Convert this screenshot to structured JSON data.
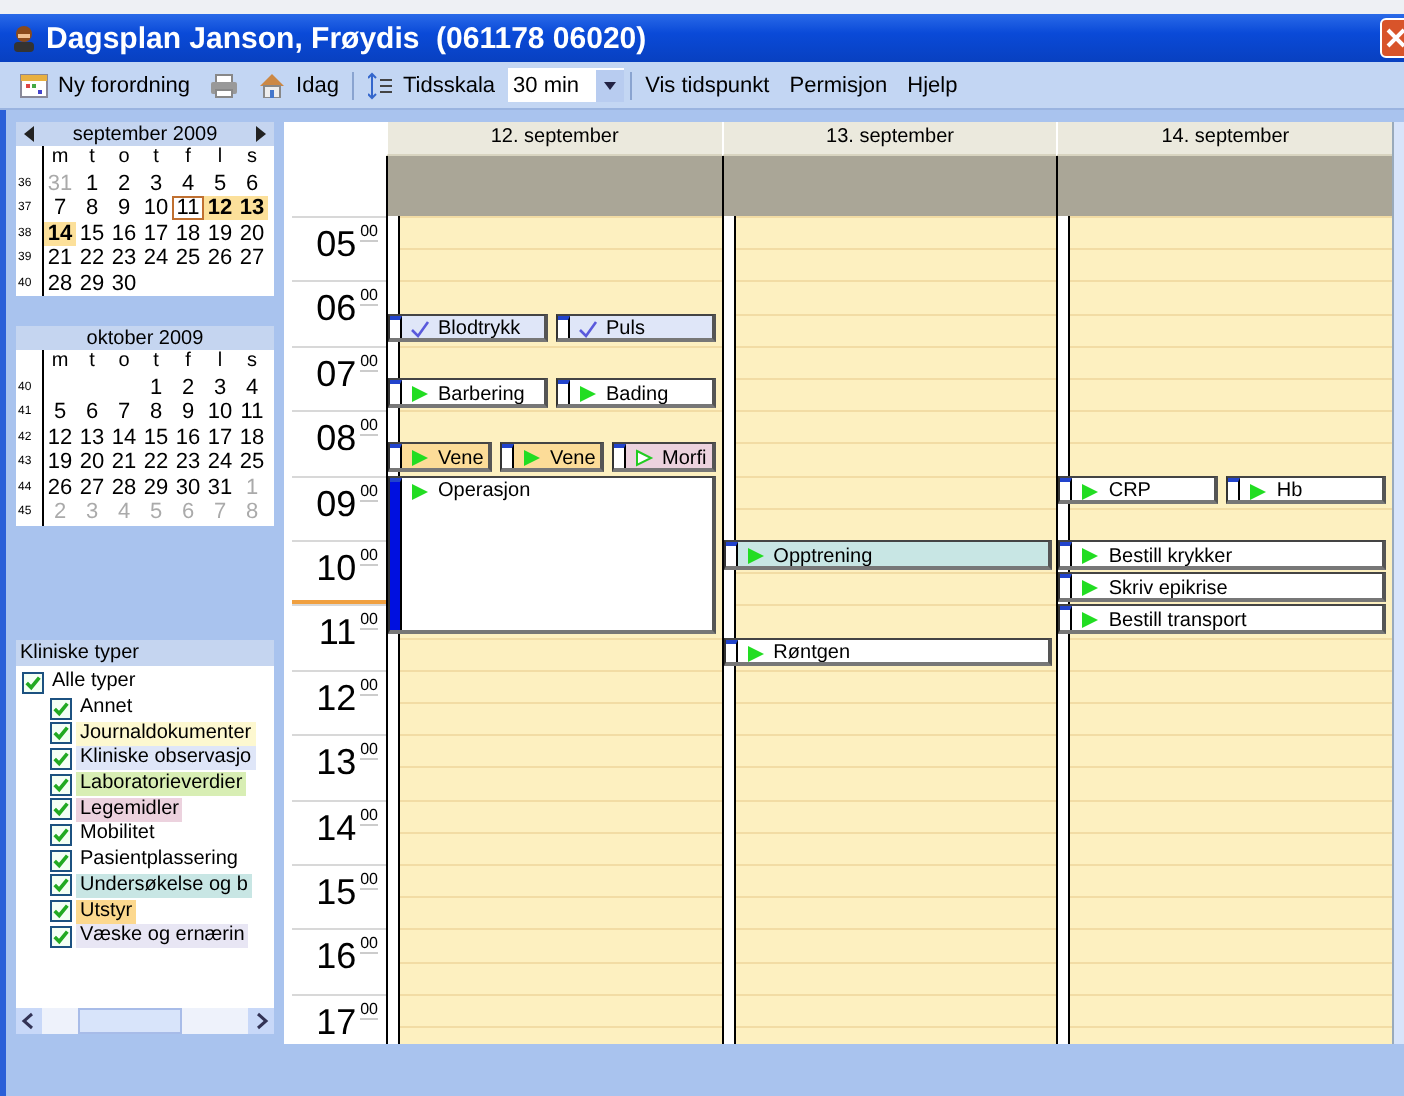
{
  "window": {
    "title": "Dagsplan Janson, Frøydis  (061178 06020)"
  },
  "toolbar": {
    "new_order": "Ny forordning",
    "today": "Idag",
    "time_scale": "Tidsskala",
    "scale_value": "30 min",
    "show_time": "Vis tidspunkt",
    "leave": "Permisjon",
    "help": "Hjelp"
  },
  "calendars": [
    {
      "title": "september 2009",
      "nav": true,
      "weekdays": [
        "m",
        "t",
        "o",
        "t",
        "f",
        "l",
        "s"
      ],
      "weeks": [
        {
          "number": "36",
          "days": [
            {
              "label": "31",
              "muted": true,
              "marked": false,
              "today": false
            },
            {
              "label": "1",
              "muted": false,
              "marked": false,
              "today": false
            },
            {
              "label": "2",
              "muted": false,
              "marked": false,
              "today": false
            },
            {
              "label": "3",
              "muted": false,
              "marked": false,
              "today": false
            },
            {
              "label": "4",
              "muted": false,
              "marked": false,
              "today": false
            },
            {
              "label": "5",
              "muted": false,
              "marked": false,
              "today": false
            },
            {
              "label": "6",
              "muted": false,
              "marked": false,
              "today": false
            }
          ]
        },
        {
          "number": "37",
          "days": [
            {
              "label": "7",
              "muted": false,
              "marked": false,
              "today": false
            },
            {
              "label": "8",
              "muted": false,
              "marked": false,
              "today": false
            },
            {
              "label": "9",
              "muted": false,
              "marked": false,
              "today": false
            },
            {
              "label": "10",
              "muted": false,
              "marked": false,
              "today": false
            },
            {
              "label": "11",
              "muted": false,
              "marked": false,
              "today": true
            },
            {
              "label": "12",
              "muted": false,
              "marked": true,
              "today": false
            },
            {
              "label": "13",
              "muted": false,
              "marked": true,
              "today": false
            }
          ]
        },
        {
          "number": "38",
          "days": [
            {
              "label": "14",
              "muted": false,
              "marked": true,
              "today": false
            },
            {
              "label": "15",
              "muted": false,
              "marked": false,
              "today": false
            },
            {
              "label": "16",
              "muted": false,
              "marked": false,
              "today": false
            },
            {
              "label": "17",
              "muted": false,
              "marked": false,
              "today": false
            },
            {
              "label": "18",
              "muted": false,
              "marked": false,
              "today": false
            },
            {
              "label": "19",
              "muted": false,
              "marked": false,
              "today": false
            },
            {
              "label": "20",
              "muted": false,
              "marked": false,
              "today": false
            }
          ]
        },
        {
          "number": "39",
          "days": [
            {
              "label": "21",
              "muted": false,
              "marked": false,
              "today": false
            },
            {
              "label": "22",
              "muted": false,
              "marked": false,
              "today": false
            },
            {
              "label": "23",
              "muted": false,
              "marked": false,
              "today": false
            },
            {
              "label": "24",
              "muted": false,
              "marked": false,
              "today": false
            },
            {
              "label": "25",
              "muted": false,
              "marked": false,
              "today": false
            },
            {
              "label": "26",
              "muted": false,
              "marked": false,
              "today": false
            },
            {
              "label": "27",
              "muted": false,
              "marked": false,
              "today": false
            }
          ]
        },
        {
          "number": "40",
          "align_end": false,
          "days": [
            {
              "label": "28",
              "muted": false,
              "marked": false,
              "today": false
            },
            {
              "label": "29",
              "muted": false,
              "marked": false,
              "today": false
            },
            {
              "label": "30",
              "muted": false,
              "marked": false,
              "today": false
            }
          ]
        }
      ]
    },
    {
      "title": "oktober 2009",
      "nav": false,
      "weekdays": [
        "m",
        "t",
        "o",
        "t",
        "f",
        "l",
        "s"
      ],
      "weeks": [
        {
          "number": "40",
          "align_end": true,
          "days": [
            {
              "label": "1",
              "muted": false,
              "marked": false,
              "today": false
            },
            {
              "label": "2",
              "muted": false,
              "marked": false,
              "today": false
            },
            {
              "label": "3",
              "muted": false,
              "marked": false,
              "today": false
            },
            {
              "label": "4",
              "muted": false,
              "marked": false,
              "today": false
            }
          ]
        },
        {
          "number": "41",
          "days": [
            {
              "label": "5",
              "muted": false,
              "marked": false,
              "today": false
            },
            {
              "label": "6",
              "muted": false,
              "marked": false,
              "today": false
            },
            {
              "label": "7",
              "muted": false,
              "marked": false,
              "today": false
            },
            {
              "label": "8",
              "muted": false,
              "marked": false,
              "today": false
            },
            {
              "label": "9",
              "muted": false,
              "marked": false,
              "today": false
            },
            {
              "label": "10",
              "muted": false,
              "marked": false,
              "today": false
            },
            {
              "label": "11",
              "muted": false,
              "marked": false,
              "today": false
            }
          ]
        },
        {
          "number": "42",
          "days": [
            {
              "label": "12",
              "muted": false,
              "marked": false,
              "today": false
            },
            {
              "label": "13",
              "muted": false,
              "marked": false,
              "today": false
            },
            {
              "label": "14",
              "muted": false,
              "marked": false,
              "today": false
            },
            {
              "label": "15",
              "muted": false,
              "marked": false,
              "today": false
            },
            {
              "label": "16",
              "muted": false,
              "marked": false,
              "today": false
            },
            {
              "label": "17",
              "muted": false,
              "marked": false,
              "today": false
            },
            {
              "label": "18",
              "muted": false,
              "marked": false,
              "today": false
            }
          ]
        },
        {
          "number": "43",
          "days": [
            {
              "label": "19",
              "muted": false,
              "marked": false,
              "today": false
            },
            {
              "label": "20",
              "muted": false,
              "marked": false,
              "today": false
            },
            {
              "label": "21",
              "muted": false,
              "marked": false,
              "today": false
            },
            {
              "label": "22",
              "muted": false,
              "marked": false,
              "today": false
            },
            {
              "label": "23",
              "muted": false,
              "marked": false,
              "today": false
            },
            {
              "label": "24",
              "muted": false,
              "marked": false,
              "today": false
            },
            {
              "label": "25",
              "muted": false,
              "marked": false,
              "today": false
            }
          ]
        },
        {
          "number": "44",
          "days": [
            {
              "label": "26",
              "muted": false,
              "marked": false,
              "today": false
            },
            {
              "label": "27",
              "muted": false,
              "marked": false,
              "today": false
            },
            {
              "label": "28",
              "muted": false,
              "marked": false,
              "today": false
            },
            {
              "label": "29",
              "muted": false,
              "marked": false,
              "today": false
            },
            {
              "label": "30",
              "muted": false,
              "marked": false,
              "today": false
            },
            {
              "label": "31",
              "muted": false,
              "marked": false,
              "today": false
            },
            {
              "label": "1",
              "muted": true,
              "marked": false,
              "today": false
            }
          ]
        },
        {
          "number": "45",
          "days": [
            {
              "label": "2",
              "muted": true,
              "marked": false,
              "today": false
            },
            {
              "label": "3",
              "muted": true,
              "marked": false,
              "today": false
            },
            {
              "label": "4",
              "muted": true,
              "marked": false,
              "today": false
            },
            {
              "label": "5",
              "muted": true,
              "marked": false,
              "today": false
            },
            {
              "label": "6",
              "muted": true,
              "marked": false,
              "today": false
            },
            {
              "label": "7",
              "muted": true,
              "marked": false,
              "today": false
            },
            {
              "label": "8",
              "muted": true,
              "marked": false,
              "today": false
            }
          ]
        }
      ]
    }
  ],
  "types": {
    "title": "Kliniske typer",
    "items": [
      {
        "label": "Alle typer",
        "checked": true,
        "children": [
          {
            "label": "Annet",
            "checked": true
          },
          {
            "label": "Journaldokumenter",
            "checked": true,
            "color": "#fdf8d0"
          },
          {
            "label": "Kliniske observasjo",
            "checked": true,
            "color": "#dfe6f8"
          },
          {
            "label": "Laboratorieverdier",
            "checked": true,
            "color": "#d8eeb4"
          },
          {
            "label": "Legemidler",
            "checked": true,
            "color": "#ecd2de"
          },
          {
            "label": "Mobilitet",
            "checked": true
          },
          {
            "label": "Pasientplassering",
            "checked": true
          },
          {
            "label": "Undersøkelse og b",
            "checked": true,
            "color": "#c8e6e4"
          },
          {
            "label": "Utstyr",
            "checked": true,
            "color": "#fcd88e"
          },
          {
            "label": "Væske og ernærin",
            "checked": true,
            "color": "#e8e6f4"
          }
        ]
      }
    ]
  },
  "hours": [
    {
      "hour": "05",
      "minutes": "00",
      "current": false
    },
    {
      "hour": "06",
      "minutes": "00",
      "current": false
    },
    {
      "hour": "07",
      "minutes": "00",
      "current": false
    },
    {
      "hour": "08",
      "minutes": "00",
      "current": false
    },
    {
      "hour": "09",
      "minutes": "00",
      "current": false
    },
    {
      "hour": "10",
      "minutes": "00",
      "current": true
    },
    {
      "hour": "11",
      "minutes": "00",
      "current": false
    },
    {
      "hour": "12",
      "minutes": "00",
      "current": false
    },
    {
      "hour": "13",
      "minutes": "00",
      "current": false
    },
    {
      "hour": "14",
      "minutes": "00",
      "current": false
    },
    {
      "hour": "15",
      "minutes": "00",
      "current": false
    },
    {
      "hour": "16",
      "minutes": "00",
      "current": false
    },
    {
      "hour": "17",
      "minutes": "00",
      "current": false
    }
  ],
  "days": [
    {
      "title": "12. september",
      "slots": [
        {
          "continued": false
        },
        {
          "continued": false
        },
        {
          "continued": false
        },
        {
          "events": [
            {
              "title": "Blodtrykk",
              "kind": "check",
              "color": "#dfe6f8",
              "selected": false
            },
            {
              "title": "Puls",
              "kind": "check",
              "color": "#dfe6f8",
              "selected": false
            }
          ]
        },
        {
          "continued": false
        },
        {
          "events": [
            {
              "title": "Barbering",
              "kind": "play",
              "color": "#ffffff",
              "selected": false
            },
            {
              "title": "Bading",
              "kind": "play",
              "color": "#ffffff",
              "selected": false
            }
          ]
        },
        {
          "continued": false
        },
        {
          "events": [
            {
              "title": "Vene",
              "kind": "play",
              "color": "#fcdc98",
              "selected": false
            },
            {
              "title": "Vene",
              "kind": "play",
              "color": "#fcdc98",
              "selected": false
            },
            {
              "title": "Morfi",
              "kind": "play-outline",
              "color": "#ecd2de",
              "selected": false
            }
          ]
        },
        {
          "events": [
            {
              "title": "Operasjon",
              "kind": "play",
              "color": "#ffffff",
              "selected": true
            }
          ]
        },
        {
          "continued": true
        },
        {
          "continued": true
        },
        {
          "continued": true
        },
        {
          "continued": true
        }
      ]
    },
    {
      "title": "13. september",
      "slots": [
        {
          "continued": false
        },
        {
          "continued": false
        },
        {
          "continued": false
        },
        {
          "continued": false
        },
        {
          "continued": false
        },
        {
          "continued": false
        },
        {
          "continued": false
        },
        {
          "continued": false
        },
        {
          "continued": false
        },
        {
          "continued": false
        },
        {
          "events": [
            {
              "title": "Opptrening",
              "kind": "play",
              "color": "#c8e6e4",
              "selected": false
            }
          ]
        },
        {
          "continued": false
        },
        {
          "continued": false
        },
        {
          "events": [
            {
              "title": "Røntgen",
              "kind": "play",
              "color": "#ffffff",
              "selected": false
            }
          ]
        }
      ]
    },
    {
      "title": "14. september",
      "slots": [
        {
          "continued": false
        },
        {
          "continued": false
        },
        {
          "continued": false
        },
        {
          "continued": false
        },
        {
          "continued": false
        },
        {
          "continued": false
        },
        {
          "continued": false
        },
        {
          "continued": false
        },
        {
          "events": [
            {
              "title": "CRP",
              "kind": "play",
              "color": "#ffffff",
              "selected": false
            },
            {
              "title": "Hb",
              "kind": "play",
              "color": "#ffffff",
              "selected": false
            }
          ]
        },
        {
          "continued": false
        },
        {
          "events": [
            {
              "title": "Bestill krykker",
              "kind": "play",
              "color": "#ffffff",
              "selected": false
            }
          ]
        },
        {
          "events": [
            {
              "title": "Skriv epikrise",
              "kind": "play",
              "color": "#ffffff",
              "selected": false
            }
          ]
        },
        {
          "events": [
            {
              "title": "Bestill transport",
              "kind": "play",
              "color": "#ffffff",
              "selected": false
            }
          ]
        }
      ]
    }
  ]
}
